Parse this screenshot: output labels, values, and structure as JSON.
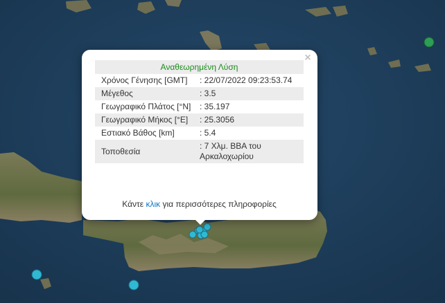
{
  "popup": {
    "title": "Αναθεωρημένη Λύση",
    "close_icon": "×",
    "rows": [
      {
        "label": "Χρόνος Γένησης [GMT]",
        "value": ": 22/07/2022 09:23:53.74"
      },
      {
        "label": "Μέγεθος",
        "value": ": 3.5"
      },
      {
        "label": "Γεωγραφικό Πλάτος [°N]",
        "value": ": 35.197"
      },
      {
        "label": "Γεωγραφικό Μήκος [°E]",
        "value": ": 25.3056"
      },
      {
        "label": "Εστιακό Βάθος [km]",
        "value": ": 5.4"
      },
      {
        "label": "Τοποθεσία",
        "value": ": 7 Χλμ. ΒΒΑ του Αρκαλοχωρίου"
      }
    ],
    "more_prefix": "Κάντε",
    "more_link": "κλικ",
    "more_suffix": "για περισσότερες πληροφορίες"
  },
  "markers": {
    "cyan_color": "#2fb9d4",
    "green_color": "#2e9d56"
  },
  "map": {
    "sea_color": "#1f3f5c",
    "land_color": "#6b6e4a"
  }
}
